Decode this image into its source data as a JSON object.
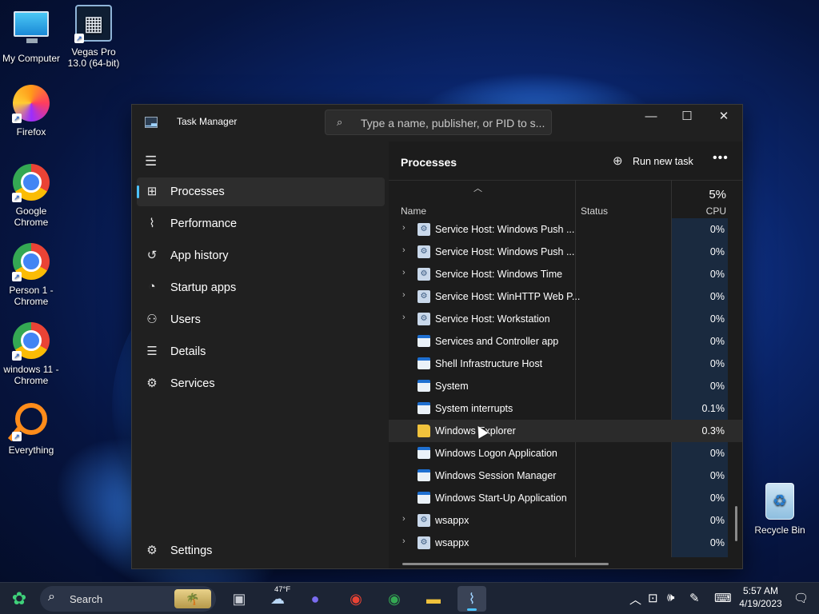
{
  "desktop": {
    "icons": [
      {
        "label": "My Computer",
        "icon": "computer-icon"
      },
      {
        "label": "Vegas Pro 13.0 (64-bit)",
        "icon": "film-icon"
      },
      {
        "label": "Firefox",
        "icon": "firefox-icon"
      },
      {
        "label": "Google Chrome",
        "icon": "chrome-icon"
      },
      {
        "label": "Person 1 - Chrome",
        "icon": "chrome-profile-icon"
      },
      {
        "label": "windows 11 - Chrome",
        "icon": "chrome-profile-icon"
      },
      {
        "label": "Everything",
        "icon": "search-tool-icon"
      },
      {
        "label": "Recycle Bin",
        "icon": "recycle-bin-icon"
      }
    ]
  },
  "window": {
    "title": "Task Manager",
    "search_placeholder": "Type a name, publisher, or PID to s..."
  },
  "nav": {
    "items": [
      {
        "label": "Processes",
        "icon": "processes-icon",
        "active": true
      },
      {
        "label": "Performance",
        "icon": "performance-icon"
      },
      {
        "label": "App history",
        "icon": "app-history-icon"
      },
      {
        "label": "Startup apps",
        "icon": "startup-icon"
      },
      {
        "label": "Users",
        "icon": "users-icon"
      },
      {
        "label": "Details",
        "icon": "details-icon"
      },
      {
        "label": "Services",
        "icon": "services-icon"
      }
    ],
    "settings_label": "Settings"
  },
  "main": {
    "title": "Processes",
    "run_new_task_label": "Run new task",
    "columns": {
      "name": "Name",
      "status": "Status",
      "cpu_total": "5%",
      "cpu": "CPU"
    },
    "processes": [
      {
        "name": "Service Host: Windows Push ...",
        "cpu": "0%",
        "expandable": true,
        "icon": "gear"
      },
      {
        "name": "Service Host: Windows Push ...",
        "cpu": "0%",
        "expandable": true,
        "icon": "gear"
      },
      {
        "name": "Service Host: Windows Time",
        "cpu": "0%",
        "expandable": true,
        "icon": "gear"
      },
      {
        "name": "Service Host: WinHTTP Web P...",
        "cpu": "0%",
        "expandable": true,
        "icon": "gear"
      },
      {
        "name": "Service Host: Workstation",
        "cpu": "0%",
        "expandable": true,
        "icon": "gear"
      },
      {
        "name": "Services and Controller app",
        "cpu": "0%",
        "expandable": false,
        "icon": "win"
      },
      {
        "name": "Shell Infrastructure Host",
        "cpu": "0%",
        "expandable": false,
        "icon": "win"
      },
      {
        "name": "System",
        "cpu": "0%",
        "expandable": false,
        "icon": "win"
      },
      {
        "name": "System interrupts",
        "cpu": "0.1%",
        "expandable": false,
        "icon": "win"
      },
      {
        "name": "Windows Explorer",
        "cpu": "0.3%",
        "expandable": false,
        "icon": "folder",
        "highlighted": true
      },
      {
        "name": "Windows Logon Application",
        "cpu": "0%",
        "expandable": false,
        "icon": "win"
      },
      {
        "name": "Windows Session Manager",
        "cpu": "0%",
        "expandable": false,
        "icon": "win"
      },
      {
        "name": "Windows Start-Up Application",
        "cpu": "0%",
        "expandable": false,
        "icon": "win"
      },
      {
        "name": "wsappx",
        "cpu": "0%",
        "expandable": true,
        "icon": "gear"
      },
      {
        "name": "wsappx",
        "cpu": "0%",
        "expandable": true,
        "icon": "gear"
      }
    ]
  },
  "taskbar": {
    "search_label": "Search",
    "weather_temp": "47°F",
    "time": "5:57 AM",
    "date": "4/19/2023"
  },
  "colors": {
    "accent": "#4cc2ff",
    "window_bg": "#202020",
    "cpu_column_bg": "#1a2a3f"
  }
}
